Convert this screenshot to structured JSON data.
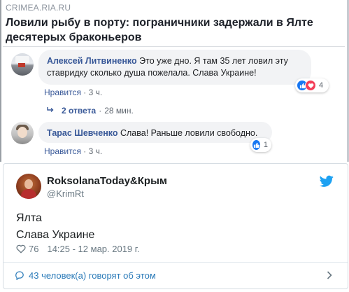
{
  "facebook": {
    "link": {
      "domain": "CRIMEA.RIA.RU",
      "title": "Ловили рыбу в порту: пограничники задержали в Ялте десятерых браконьеров"
    },
    "comments": [
      {
        "author": "Алексей Литвиненко",
        "text": "Это уже дно. Я там 35 лет ловил эту ставридку сколько душа пожелала. Слава Украине!",
        "like_label": "Нравится",
        "time": "3 ч.",
        "reaction_count": "4",
        "reactions": [
          "like-icon",
          "love-icon"
        ]
      },
      {
        "author": "Тарас Шевченко",
        "text": "Слава! Раньше ловили свободно.",
        "like_label": "Нравится",
        "time": "3 ч.",
        "reaction_count": "1",
        "reactions": [
          "like-icon"
        ]
      }
    ],
    "replies": {
      "label": "2 ответа",
      "time": "28 мин."
    },
    "separator": "·",
    "colors": {
      "link_blue": "#385898",
      "bubble_bg": "#f2f3f5",
      "like_blue": "#1877f2",
      "love_red": "#f33e58"
    }
  },
  "tweet": {
    "name": "RoksolanaToday&Крым",
    "handle": "@KrimRt",
    "lines": [
      "Ялта",
      "Слава Украине"
    ],
    "likes": "76",
    "timestamp": "14:25 - 12 мар. 2019 г.",
    "talk": "43 человек(а) говорят об этом",
    "icons": {
      "brand": "twitter-bird-icon",
      "like": "heart-icon",
      "talk": "speech-bubble-icon",
      "more": "chevron-right-icon"
    },
    "colors": {
      "brand": "#1da1f2",
      "link": "#2b7bb9",
      "muted": "#697882"
    }
  }
}
